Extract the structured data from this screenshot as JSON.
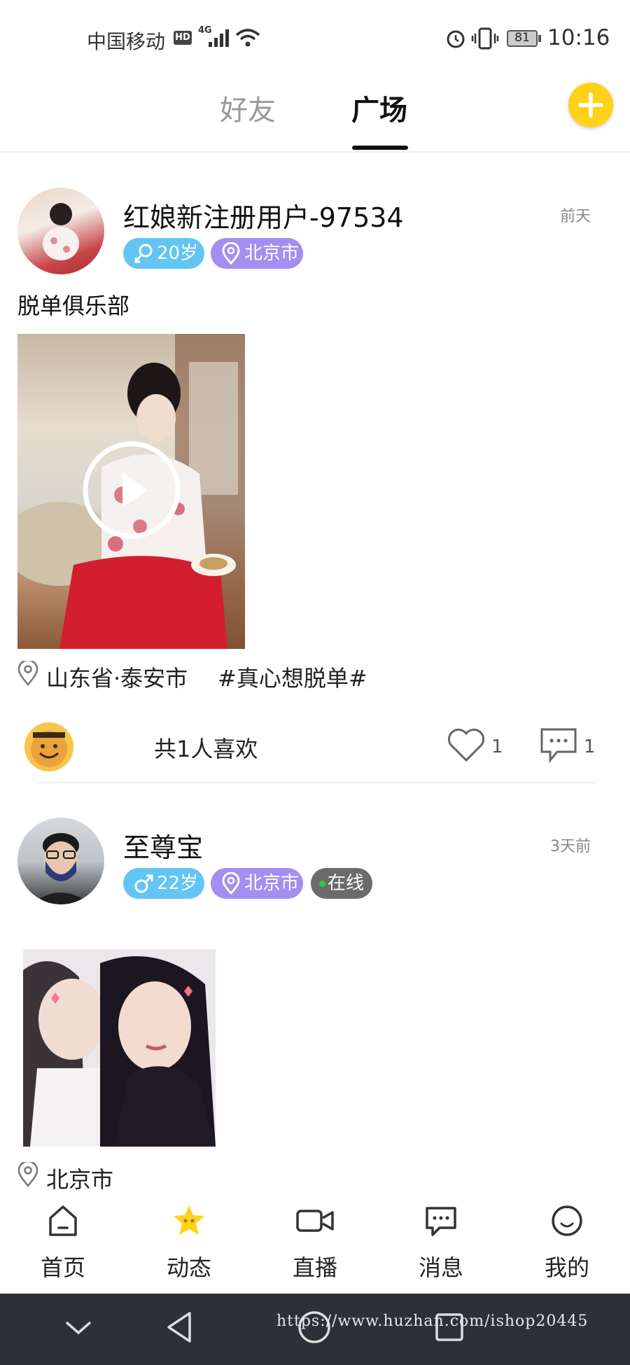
{
  "status_bar": {
    "carrier": "中国移动",
    "hd": "HD",
    "network": "4G",
    "battery": "81",
    "time": "10:16"
  },
  "tabs": [
    {
      "label": "好友",
      "active": false
    },
    {
      "label": "广场",
      "active": true
    }
  ],
  "posts": [
    {
      "username": "红娘新注册用户-97534",
      "time": "前天",
      "age_tag": "20岁",
      "gender": "female",
      "city_tag": "北京市",
      "text": "脱单俱乐部",
      "media": "video",
      "location": "山东省·泰安市",
      "topic": "#真心想脱单#",
      "likes_text": "共1人喜欢",
      "like_count": "1",
      "comment_count": "1"
    },
    {
      "username": "至尊宝",
      "time": "3天前",
      "age_tag": "22岁",
      "gender": "male",
      "city_tag": "北京市",
      "online_tag": "在线",
      "media": "image",
      "location": "北京市"
    }
  ],
  "bottom_nav": [
    {
      "label": "首页",
      "icon": "home-icon"
    },
    {
      "label": "动态",
      "icon": "star-face-icon",
      "active": true
    },
    {
      "label": "直播",
      "icon": "video-camera-icon"
    },
    {
      "label": "消息",
      "icon": "message-icon"
    },
    {
      "label": "我的",
      "icon": "smiley-profile-icon"
    }
  ],
  "watermark": "https://www.huzhan.com/ishop20445",
  "colors": {
    "accent_yellow": "#ffd21a",
    "age_tag": "#63c5f3",
    "city_tag": "#a48ef0",
    "online_tag": "#6b6b6b",
    "online_dot": "#2ecc40",
    "system_bar": "#2b3138"
  }
}
